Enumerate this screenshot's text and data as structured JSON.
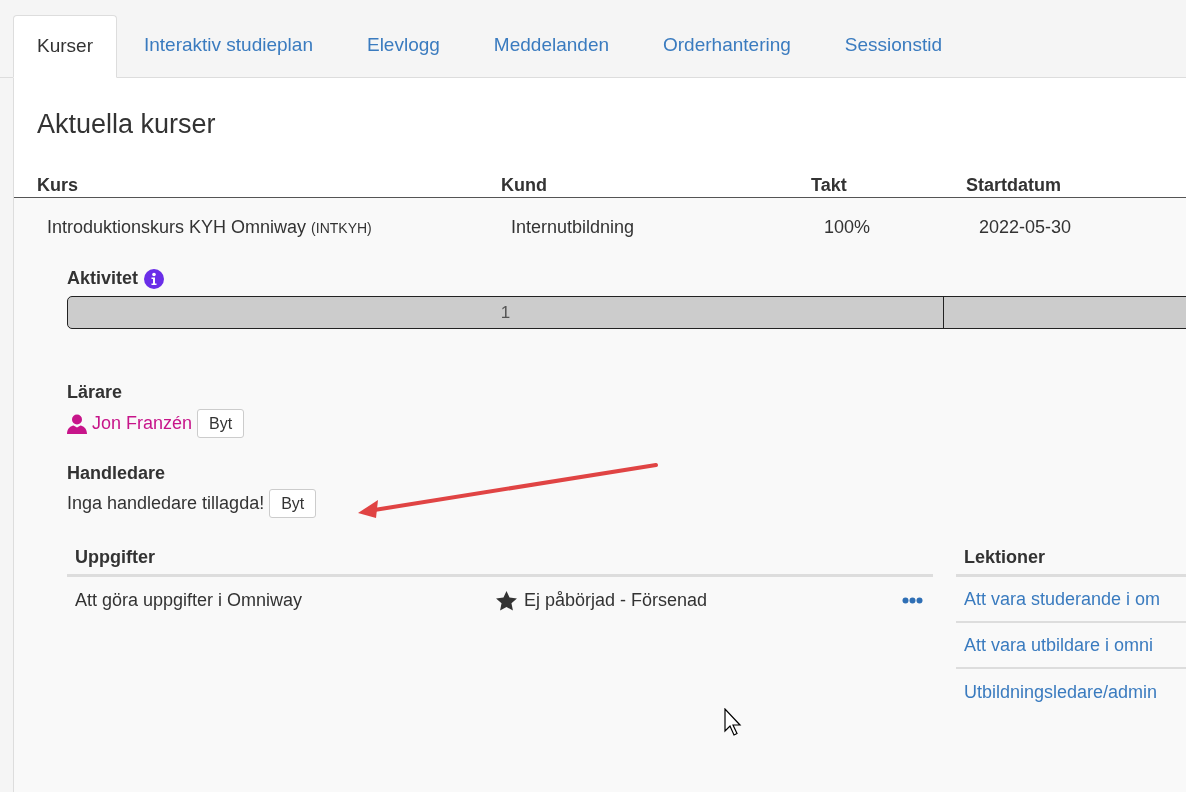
{
  "tabs": [
    {
      "label": "Kurser",
      "selected": true
    },
    {
      "label": "Interaktiv studieplan",
      "selected": false
    },
    {
      "label": "Elevlogg",
      "selected": false
    },
    {
      "label": "Meddelanden",
      "selected": false
    },
    {
      "label": "Orderhantering",
      "selected": false
    },
    {
      "label": "Sessionstid",
      "selected": false
    }
  ],
  "heading": "Aktuella kurser",
  "courses": {
    "columns": [
      "Kurs",
      "Kund",
      "Takt",
      "Startdatum"
    ],
    "rows": [
      {
        "name": "Introduktionskurs KYH Omniway",
        "code": "(INTKYH)",
        "customer": "Internutbildning",
        "pace": "100%",
        "start_date": "2022-05-30"
      }
    ]
  },
  "activity": {
    "label": "Aktivitet",
    "segments": [
      {
        "kind": "labeled",
        "label": "1"
      },
      {
        "kind": "blank"
      }
    ]
  },
  "teachers": {
    "label": "Lärare",
    "names": [
      "Jon Franzén"
    ],
    "button": "Byt"
  },
  "supervisors": {
    "label": "Handledare",
    "empty_text": "Inga handledare tillagda!",
    "button": "Byt"
  },
  "annotation": {
    "kind": "arrow"
  },
  "tasks": {
    "title": "Uppgifter",
    "rows": [
      {
        "name": "Att göra uppgifter i Omniway",
        "status": "Ej påbörjad - Försenad"
      }
    ]
  },
  "lessons": {
    "title": "Lektioner",
    "rows": [
      {
        "name": "Att vara studerande i om"
      },
      {
        "name": "Att vara utbildare i omni"
      },
      {
        "name": "Utbildningsledare/admin"
      }
    ]
  }
}
